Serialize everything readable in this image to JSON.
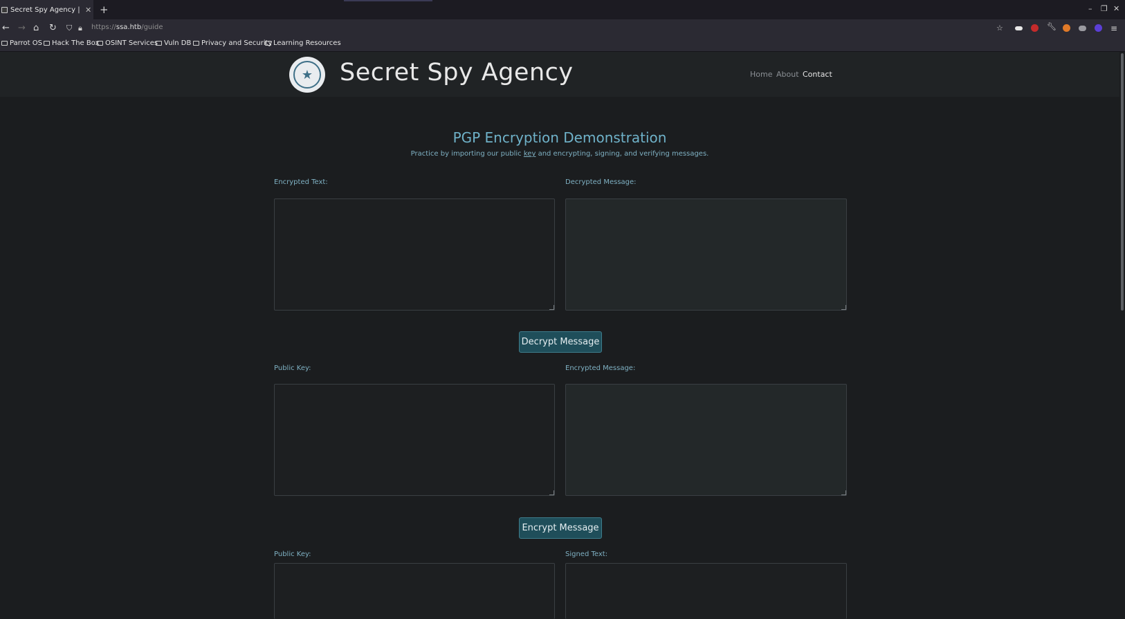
{
  "browser": {
    "tab_title": "Secret Spy Agency | PGP",
    "tab_close": "✕",
    "new_tab": "+",
    "url_scheme": "https://",
    "url_host": "ssa.htb",
    "url_path": "/guide",
    "bookmarks": [
      "Parrot OS",
      "Hack The Box",
      "OSINT Services",
      "Vuln DB",
      "Privacy and Security",
      "Learning Resources"
    ]
  },
  "site": {
    "title": "Secret Spy Agency",
    "nav": {
      "home": "Home",
      "about": "About",
      "contact": "Contact"
    }
  },
  "main": {
    "heading": "PGP Encryption Demonstration",
    "sub_prefix": "Practice by importing our public ",
    "sub_link": "key",
    "sub_suffix": " and encrypting, signing, and verifying messages."
  },
  "decrypt_section": {
    "left_label": "Encrypted Text:",
    "right_label": "Decrypted Message:",
    "button": "Decrypt Message"
  },
  "encrypt_section": {
    "left_label": "Public Key:",
    "right_label": "Encrypted Message:",
    "button": "Encrypt Message"
  },
  "verify_section": {
    "left_label": "Public Key:",
    "right_label": "Signed Text:"
  },
  "colors": {
    "page_bg": "#1b1d1f",
    "header_bg": "#202325",
    "accent": "#6fb2c9",
    "button_bg": "#1f4e5a"
  }
}
